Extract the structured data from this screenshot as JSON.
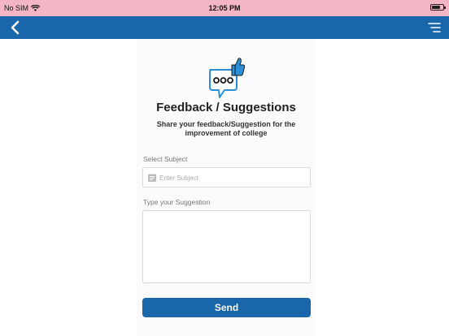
{
  "status_bar": {
    "carrier": "No SIM",
    "time": "12:05 PM"
  },
  "nav": {
    "back_icon": "chevron-left-icon",
    "menu_icon": "menu-lines-icon"
  },
  "form": {
    "title": "Feedback / Suggestions",
    "subtitle_line1": "Share your feedback/Suggestion for the",
    "subtitle_line2": "improvement of college",
    "subject_label": "Select Subject",
    "subject_placeholder": "Enter Subject",
    "suggestion_label": "Type your Suggestion",
    "send_label": "Send"
  },
  "colors": {
    "status_bar": "#f4b5c4",
    "nav_bar": "#1a66aa",
    "button": "#1a66aa",
    "icon_accent": "#2a8fd8"
  }
}
